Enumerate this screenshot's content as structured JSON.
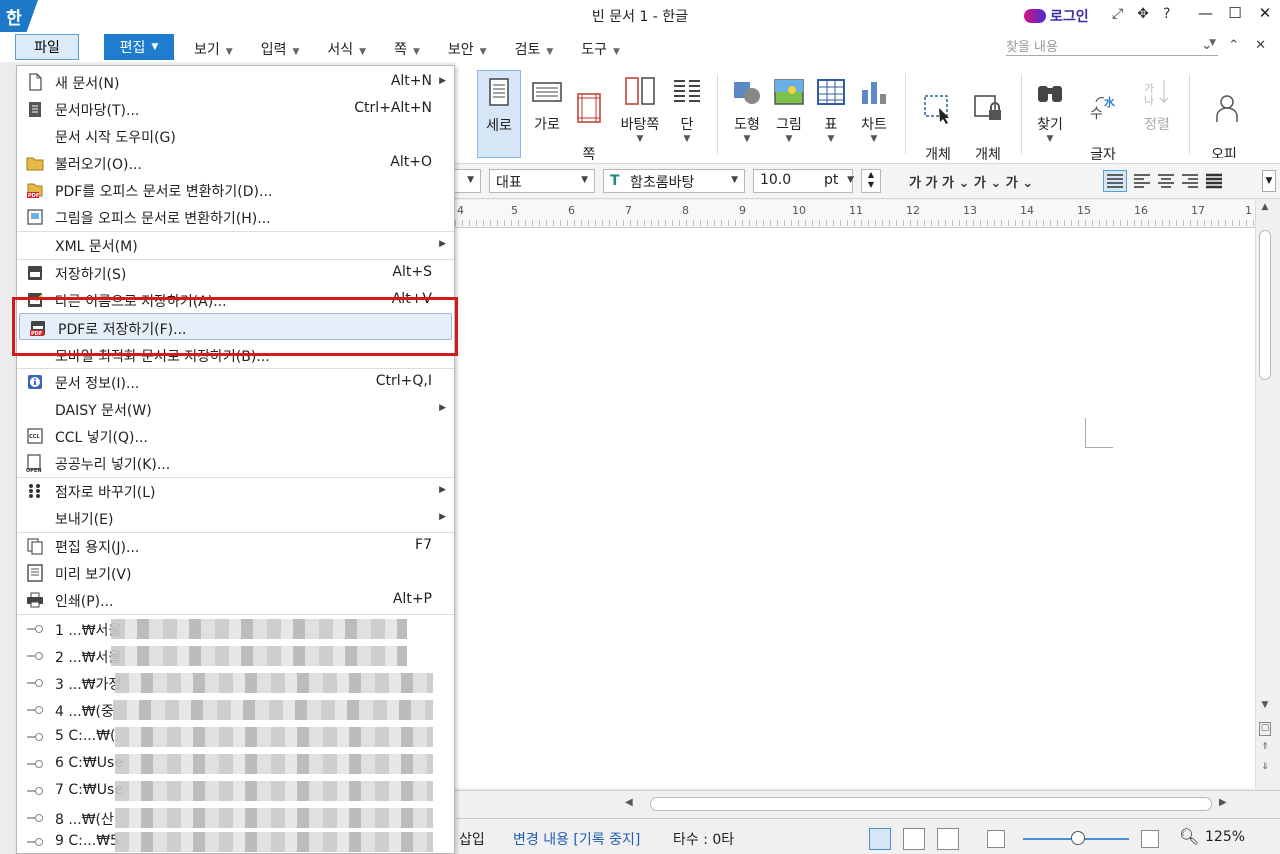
{
  "window": {
    "title": "빈 문서 1 - 한글",
    "logo": "한",
    "login": "로그인",
    "tool_icons": [
      "⤢",
      "✥",
      "?"
    ],
    "controls": [
      "—",
      "☐",
      "✕"
    ]
  },
  "menubar": {
    "file": "파일",
    "edit": "편집",
    "items": [
      "보기",
      "입력",
      "서식",
      "쪽",
      "보안",
      "검토",
      "도구"
    ],
    "search_placeholder": "찾을 내용",
    "right_icons": [
      "⌄",
      "⌃",
      "✕"
    ]
  },
  "ribbon": {
    "buttons": [
      {
        "label": "세로",
        "selected": true
      },
      {
        "label": "가로"
      },
      {
        "label": "쪽\n여백"
      },
      {
        "label": "바탕쪽"
      },
      {
        "label": "단"
      },
      {
        "label": "도형"
      },
      {
        "label": "그림"
      },
      {
        "label": "표"
      },
      {
        "label": "차트"
      },
      {
        "label": "개체\n선택"
      },
      {
        "label": "개체\n보호"
      },
      {
        "label": "찾기"
      },
      {
        "label": "글자\n바꾸기"
      },
      {
        "label": "정렬"
      },
      {
        "label": "오피\n커뮤니"
      }
    ]
  },
  "format": {
    "style": "대표",
    "font": "함초롬바탕",
    "size": "10.0",
    "unit": "pt",
    "char_icons": "가  가  가 ⌄  가 ⌄  가 ⌄"
  },
  "ruler": {
    "ticks": [
      "4",
      "5",
      "6",
      "7",
      "8",
      "9",
      "10",
      "11",
      "12",
      "13",
      "14",
      "15",
      "16",
      "17",
      "1"
    ]
  },
  "status": {
    "insert": "삽입",
    "track": "변경 내용 [기록 중지]",
    "strokes": "타수 : 0타",
    "zoom": "125%"
  },
  "file_menu": {
    "items": [
      {
        "label": "새 문서(N)",
        "shortcut": "Alt+N",
        "submenu": true,
        "icon": "new-document-icon"
      },
      {
        "label": "문서마당(T)...",
        "shortcut": "Ctrl+Alt+N",
        "icon": "template-icon"
      },
      {
        "label": "문서 시작 도우미(G)",
        "shortcut": "",
        "icon": ""
      },
      {
        "label": "불러오기(O)...",
        "shortcut": "Alt+O",
        "icon": "open-folder-icon"
      },
      {
        "label": "PDF를 오피스 문서로 변환하기(D)...",
        "shortcut": "",
        "icon": "pdf-convert-icon"
      },
      {
        "label": "그림을 오피스 문서로 변환하기(H)...",
        "shortcut": "",
        "icon": "image-convert-icon"
      },
      {
        "label": "XML 문서(M)",
        "shortcut": "",
        "submenu": true,
        "icon": ""
      },
      {
        "label": "저장하기(S)",
        "shortcut": "Alt+S",
        "icon": "save-icon"
      },
      {
        "label": "다른 이름으로 저장하기(A)...",
        "shortcut": "Alt+V",
        "icon": "save-as-icon"
      },
      {
        "label": "PDF로 저장하기(F)...",
        "shortcut": "",
        "icon": "save-pdf-icon",
        "highlighted": true
      },
      {
        "label": "모바일 최적화 문서로 저장하기(B)...",
        "shortcut": "",
        "icon": ""
      },
      {
        "label": "문서 정보(I)...",
        "shortcut": "Ctrl+Q,I",
        "icon": "info-icon"
      },
      {
        "label": "DAISY 문서(W)",
        "shortcut": "",
        "submenu": true,
        "icon": ""
      },
      {
        "label": "CCL 넣기(Q)...",
        "shortcut": "",
        "icon": "ccl-icon"
      },
      {
        "label": "공공누리 넣기(K)...",
        "shortcut": "",
        "icon": "kogl-icon"
      },
      {
        "label": "점자로 바꾸기(L)",
        "shortcut": "",
        "submenu": true,
        "icon": "braille-icon"
      },
      {
        "label": "보내기(E)",
        "shortcut": "",
        "submenu": true,
        "icon": ""
      },
      {
        "label": "편집 용지(J)...",
        "shortcut": "F7",
        "icon": "page-setup-icon"
      },
      {
        "label": "미리 보기(V)",
        "shortcut": "",
        "icon": "preview-icon"
      },
      {
        "label": "인쇄(P)...",
        "shortcut": "Alt+P",
        "icon": "print-icon"
      }
    ],
    "recent": [
      "1 ...₩서울",
      "2 ...₩서울",
      "3 ...₩가정",
      "4 ...₩(중",
      "5 C:...₩(",
      "6 C:₩Use",
      "7 C:₩Use",
      "8 ...₩(산",
      "9 C:...₩5"
    ]
  }
}
